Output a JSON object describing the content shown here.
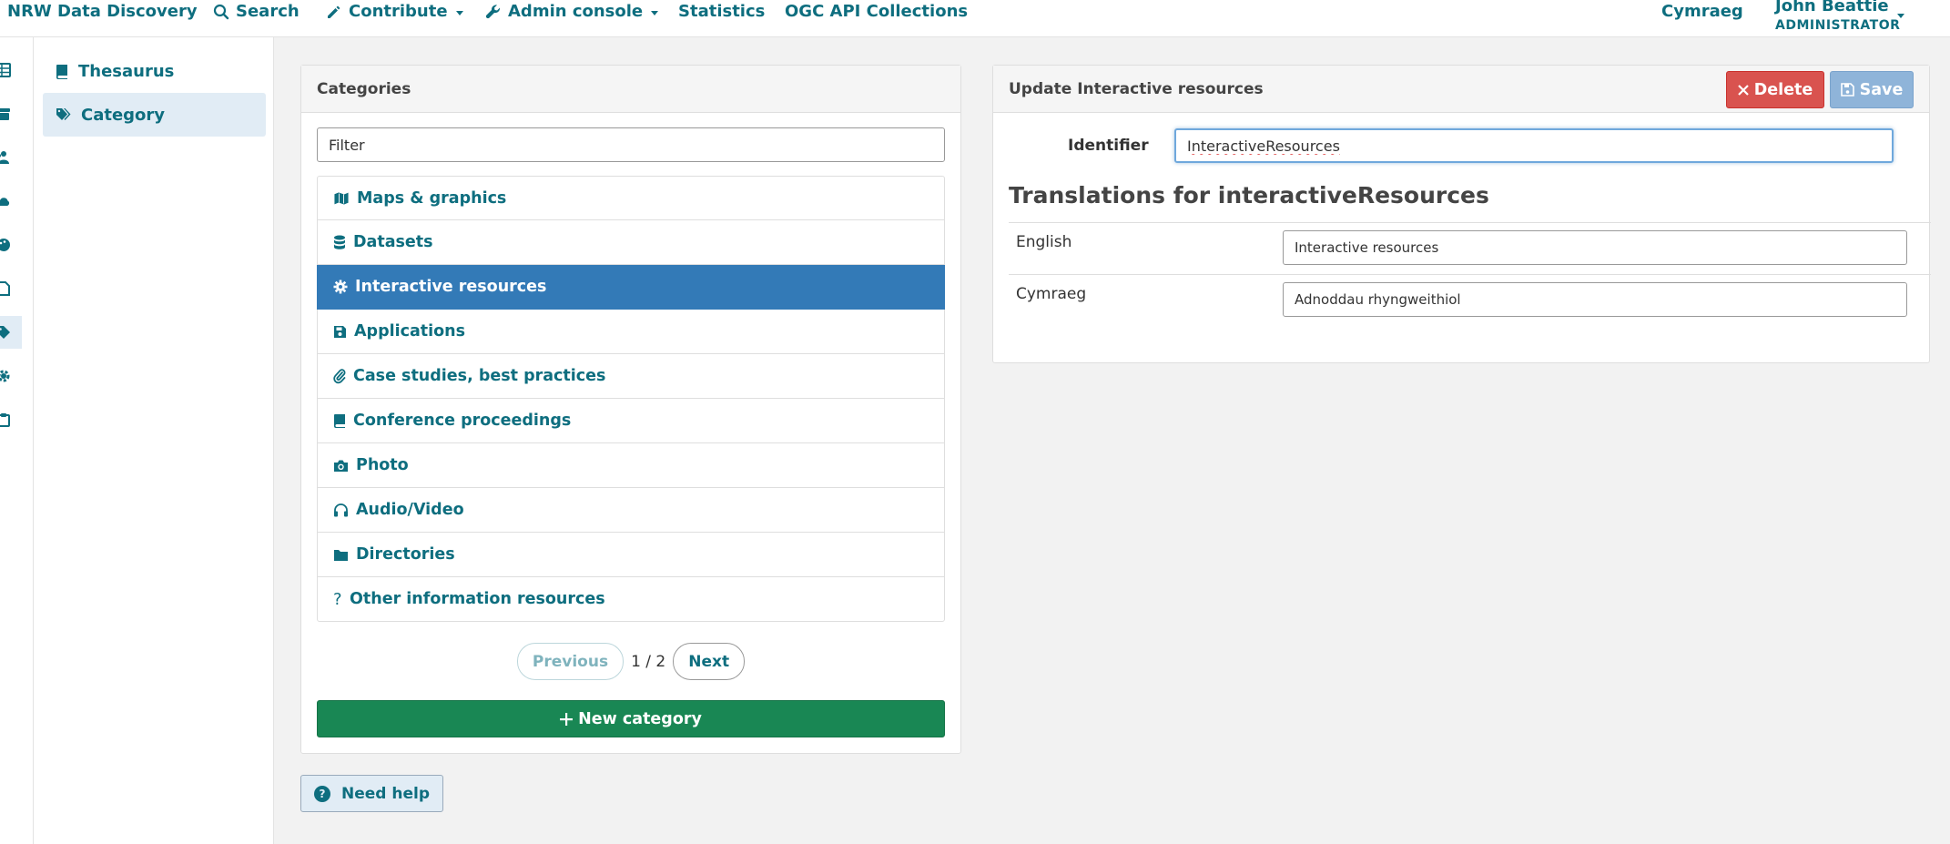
{
  "navbar": {
    "brand": "NRW Data Discovery",
    "search": "Search",
    "contribute": "Contribute",
    "admin_console": "Admin console",
    "statistics": "Statistics",
    "ogc": "OGC API Collections",
    "language": "Cymraeg",
    "user_name": "John Beattie",
    "user_role": "ADMINISTRATOR"
  },
  "rail_icons": [
    "grid-icon",
    "archive-icon",
    "users-icon",
    "cloud-icon",
    "palette-icon",
    "file-icon",
    "tags-icon",
    "cog-icon",
    "clipboard-icon"
  ],
  "sidebar": {
    "items": [
      {
        "label": "Thesaurus",
        "icon": "book-icon"
      },
      {
        "label": "Category",
        "icon": "tags-icon",
        "active": true
      }
    ]
  },
  "categories": {
    "title": "Categories",
    "filter_placeholder": "Filter",
    "items": [
      {
        "label": "Maps & graphics",
        "icon": "map-icon"
      },
      {
        "label": "Datasets",
        "icon": "database-icon"
      },
      {
        "label": "Interactive resources",
        "icon": "gear-icon",
        "active": true
      },
      {
        "label": "Applications",
        "icon": "floppy-icon"
      },
      {
        "label": "Case studies, best practices",
        "icon": "paperclip-icon"
      },
      {
        "label": "Conference proceedings",
        "icon": "book-icon"
      },
      {
        "label": "Photo",
        "icon": "camera-icon"
      },
      {
        "label": "Audio/Video",
        "icon": "headphones-icon"
      },
      {
        "label": "Directories",
        "icon": "folder-icon"
      },
      {
        "label": "Other information resources",
        "icon": "question-icon"
      }
    ],
    "pager": {
      "previous": "Previous",
      "info": "1 / 2",
      "next": "Next"
    },
    "new_button": "New category"
  },
  "help_button": "Need help",
  "update": {
    "title": "Update Interactive resources",
    "delete_label": "Delete",
    "save_label": "Save",
    "identifier_label": "Identifier",
    "identifier_value": "InteractiveResources",
    "translations_title": "Translations for interactiveResources",
    "translations": [
      {
        "lang": "English",
        "value": "Interactive resources"
      },
      {
        "lang": "Cymraeg",
        "value": "Adnoddau rhyngweithiol"
      }
    ]
  },
  "colors": {
    "brand": "#0e6e7f",
    "active_row": "#337ab7",
    "new_button": "#198754",
    "delete_button": "#d9534f",
    "save_button": "#8fb4d9"
  }
}
